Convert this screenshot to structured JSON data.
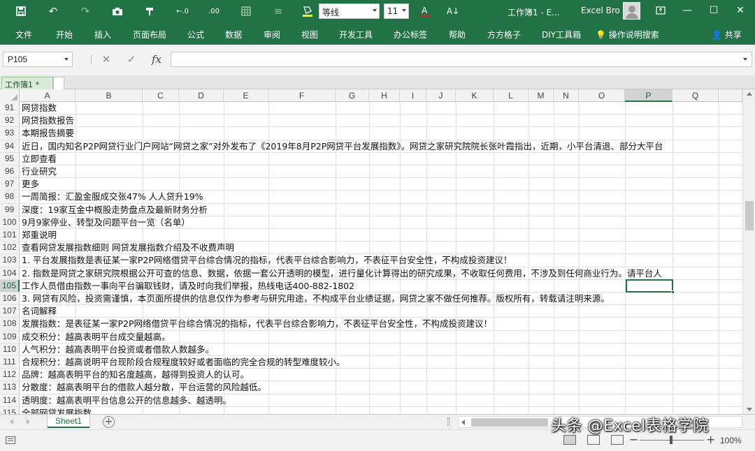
{
  "titlebar": {
    "font_name": "等线",
    "font_size": "11",
    "window_title": "工作簿1 - E...",
    "user_name": "Excel Bro",
    "accent_color": "#217346"
  },
  "ribbon": {
    "tabs": [
      "文件",
      "开始",
      "插入",
      "页面布局",
      "公式",
      "数据",
      "审阅",
      "视图",
      "开发工具",
      "办公标签",
      "帮助",
      "方方格子",
      "DIY工具箱",
      "操作说明搜索"
    ],
    "share": "共享"
  },
  "formula_bar": {
    "name_box": "P105",
    "fx": "fx",
    "value": ""
  },
  "workbook_tab": "工作簿1 *",
  "columns": [
    "A",
    "B",
    "C",
    "D",
    "E",
    "F",
    "G",
    "H",
    "I",
    "J",
    "K",
    "L",
    "M",
    "N",
    "O",
    "P",
    "Q"
  ],
  "selected_column": "P",
  "selected_row": "105",
  "rows": [
    {
      "num": "91",
      "text": "网贷指数"
    },
    {
      "num": "92",
      "text": "网贷指数报告"
    },
    {
      "num": "93",
      "text": "本期报告摘要"
    },
    {
      "num": "94",
      "text": "近日，国内知名P2P网贷行业门户网站“网贷之家”对外发布了《2019年8月P2P网贷平台发展指数》。网贷之家研究院院长张叶霞指出，近期，小平台清退、部分大平台"
    },
    {
      "num": "95",
      "text": "立即查看"
    },
    {
      "num": "96",
      "text": "行业研究"
    },
    {
      "num": "97",
      "text": "更多"
    },
    {
      "num": "98",
      "text": "一周简报：汇盈金服成交张47% 人人贷升19%"
    },
    {
      "num": "99",
      "text": "深度：19家互金中概股走势盘点及最新财务分析"
    },
    {
      "num": "100",
      "text": "9月9家停业、转型及问题平台一览（名单）"
    },
    {
      "num": "101",
      "text": "郑重说明"
    },
    {
      "num": "102",
      "text": "查看网贷发展指数细则 网贷发展指数介绍及不收费声明"
    },
    {
      "num": "103",
      "text": "1. 平台发展指数是表征某一家P2P网络借贷平台综合情况的指标，代表平台综合影响力，不表征平台安全性，不构成投资建议！"
    },
    {
      "num": "104",
      "text": "2. 指数是网贷之家研究院根据公开可查的信息、数据，依据一套公开透明的模型，进行量化计算得出的研究成果，不收取任何费用，不涉及到任何商业行为。请平台人"
    },
    {
      "num": "105",
      "text": "工作人员借由指数一事向平台骗取钱财，请及时向我们举报，热线电话400-882-1802"
    },
    {
      "num": "106",
      "text": "3. 网贷有风险，投资需谨慎，本页面所提供的信息仅作为参考与研究用途，不构成平台业绩证据，网贷之家不做任何推荐。版权所有，转载请注明来源。"
    },
    {
      "num": "107",
      "text": "名词解释"
    },
    {
      "num": "108",
      "text": "发展指数：是表征某一家P2P网络借贷平台综合情况的指标，代表平台综合影响力，不表征平台安全性，不构成投资建议！"
    },
    {
      "num": "109",
      "text": "成交积分：越高表明平台成交量越高。"
    },
    {
      "num": "110",
      "text": "人气积分：越高表明平台投资或者借款人数越多。"
    },
    {
      "num": "111",
      "text": "合规积分：越高说明平台现阶段合规程度较好或者面临的完全合规的转型难度较小。"
    },
    {
      "num": "112",
      "text": "品牌：越高表明平台的知名度越高，越得到投资人的认可。"
    },
    {
      "num": "113",
      "text": "分散度：越高表明平台的借款人越分散，平台运营的风险越低。"
    },
    {
      "num": "114",
      "text": "透明度：越高表明平台信息公开的信息越多、越透明。"
    },
    {
      "num": "115",
      "text": "全部网贷发展指数"
    }
  ],
  "sheet_tab": "Sheet1",
  "status": {
    "zoom": "100%"
  },
  "watermark": "头条 @Excel表格学院"
}
